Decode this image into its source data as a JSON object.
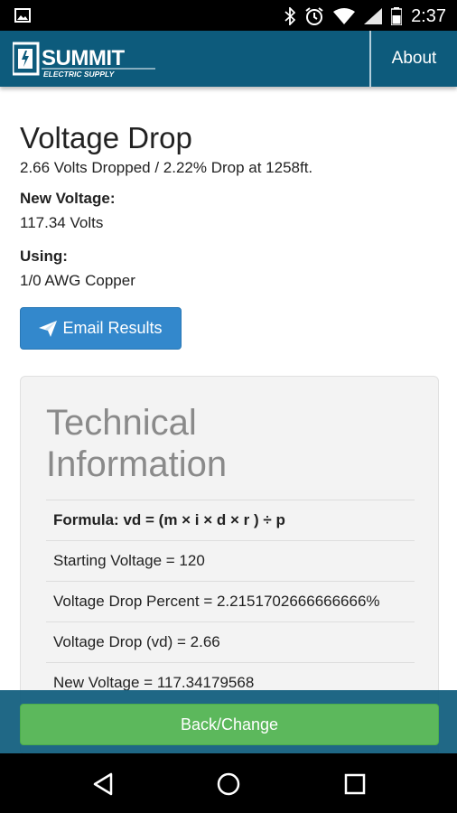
{
  "status_bar": {
    "time": "2:37"
  },
  "app_bar": {
    "brand_main": "SUMMIT",
    "brand_sub": "ELECTRIC SUPPLY",
    "about_label": "About"
  },
  "result": {
    "title": "Voltage Drop",
    "summary": "2.66 Volts Dropped / 2.22% Drop at 1258ft.",
    "new_voltage_label": "New Voltage:",
    "new_voltage_value": "117.34 Volts",
    "using_label": "Using:",
    "using_value": "1/0 AWG Copper",
    "email_button": "Email Results"
  },
  "technical": {
    "title_line1": "Technical",
    "title_line2": "Information",
    "rows": [
      "Formula: vd = (m × i × d × r ) ÷ p",
      "Starting Voltage = 120",
      "Voltage Drop Percent = 2.2151702666666666%",
      "Voltage Drop (vd) = 2.66",
      "New Voltage = 117.34179568"
    ]
  },
  "footer": {
    "back_button": "Back/Change"
  }
}
